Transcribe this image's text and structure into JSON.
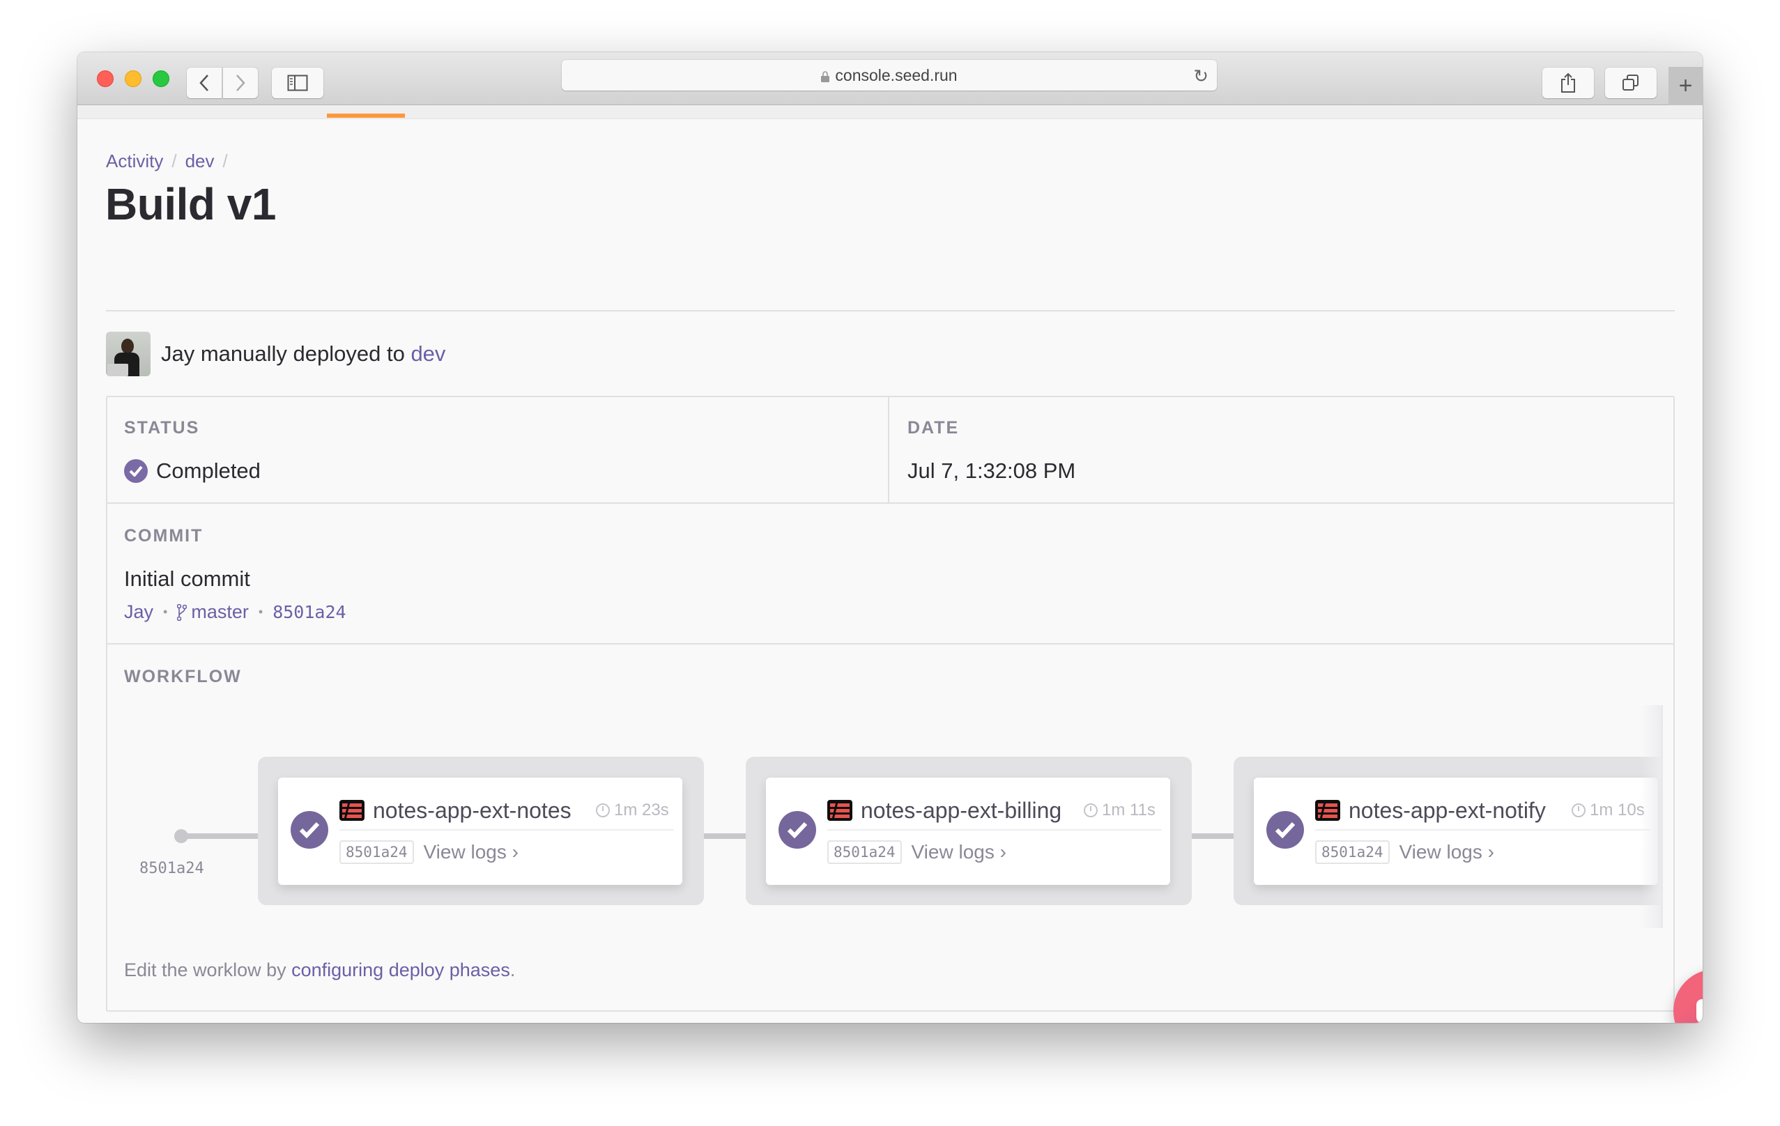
{
  "browser": {
    "url": "console.seed.run",
    "buttons": {
      "back": "back",
      "forward": "forward",
      "sidebar": "sidebar",
      "share": "share",
      "tabs": "tabs",
      "new_tab": "+"
    }
  },
  "breadcrumb": {
    "items": [
      "Activity",
      "dev"
    ],
    "separator": "/"
  },
  "page": {
    "title": "Build v1"
  },
  "deploy": {
    "user": "Jay",
    "text": "Jay manually deployed to ",
    "target": "dev"
  },
  "status": {
    "label": "STATUS",
    "value": "Completed"
  },
  "date": {
    "label": "DATE",
    "value": "Jul 7, 1:32:08 PM"
  },
  "commit": {
    "label": "COMMIT",
    "message": "Initial commit",
    "author": "Jay",
    "branch": "master",
    "sha": "8501a24",
    "separator": "•"
  },
  "workflow": {
    "label": "WORKFLOW",
    "start_sha": "8501a24",
    "stages": [
      {
        "service": "notes-app-ext-notes",
        "duration": "1m 23s",
        "sha": "8501a24",
        "logs_label": "View logs",
        "status": "completed"
      },
      {
        "service": "notes-app-ext-billing",
        "duration": "1m 11s",
        "sha": "8501a24",
        "logs_label": "View logs",
        "status": "completed"
      },
      {
        "service": "notes-app-ext-notify",
        "duration": "1m 10s",
        "sha": "8501a24",
        "logs_label": "View logs",
        "status": "completed"
      }
    ],
    "note_prefix": "Edit the worklow by ",
    "note_link": "configuring deploy phases",
    "note_suffix": "."
  },
  "colors": {
    "accent": "#6c5fa6",
    "check": "#75679c",
    "tab_indicator": "#fb983c",
    "chat_gradient_start": "#f26479",
    "chat_gradient_end": "#c44b8c"
  }
}
